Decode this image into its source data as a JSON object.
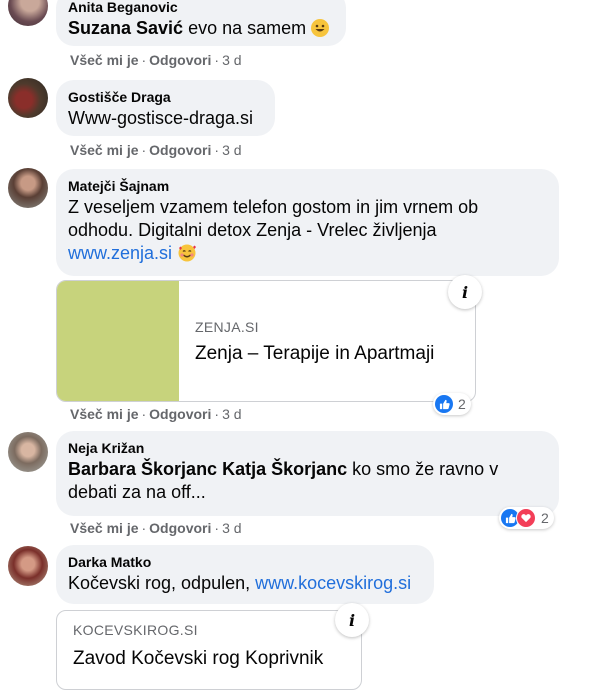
{
  "actions": {
    "like": "Všeč mi je",
    "reply": "Odgovori",
    "sep": "·",
    "time": "3 d"
  },
  "comments": [
    {
      "author": "Anita Beganovic",
      "mention": "Suzana Savić",
      "text": "evo na samem",
      "emoji": "grinning-face"
    },
    {
      "author": "Gostišče Draga",
      "text": "Www-gostisce-draga.si"
    },
    {
      "author": "Matejči Šajnam",
      "text_line1": "Z veseljem vzamem telefon gostom in jim vrnem ob",
      "text_line2": "odhodu. Digitalni detox Zenja - Vrelec življenja",
      "link": "www.zenja.si",
      "emoji": "smiling-face-with-hearts",
      "preview": {
        "domain": "ZENJA.SI",
        "title": "Zenja – Terapije in Apartmaji",
        "image_color": "#c7d37c"
      },
      "reactions": {
        "count": "2",
        "types": [
          "like"
        ]
      }
    },
    {
      "author": "Neja Križan",
      "mention": "Barbara Škorjanc Katja Škorjanc",
      "text_line1": "ko smo že ravno v",
      "text_line2": "debati za na off...",
      "reactions": {
        "count": "2",
        "types": [
          "like",
          "love"
        ]
      }
    },
    {
      "author": "Darka Matko",
      "text": "Kočevski rog, odpulen,",
      "link": "www.kocevskirog.si",
      "preview": {
        "domain": "KOCEVSKIROG.SI",
        "title": "Zavod Kočevski rog Koprivnik"
      }
    }
  ],
  "colors": {
    "bubble": "#f0f2f5",
    "link": "#216fdb",
    "meta": "#65676b",
    "like": "#1877f2",
    "love": "#f33e58"
  }
}
